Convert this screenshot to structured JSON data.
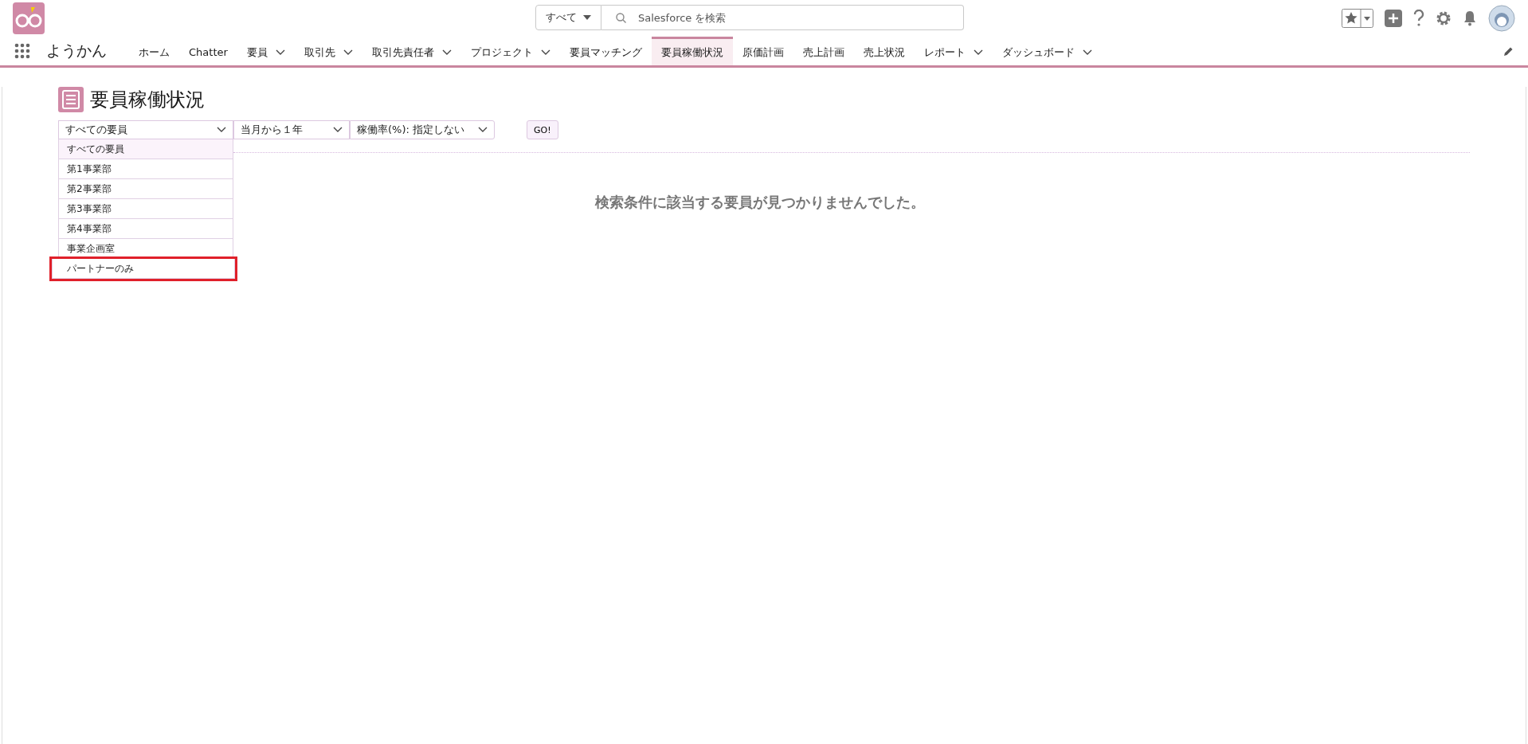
{
  "search": {
    "scope": "すべて",
    "placeholder": "Salesforce を検索"
  },
  "app_name": "ようかん",
  "nav": [
    {
      "label": "ホーム",
      "menu": false,
      "selected": false
    },
    {
      "label": "Chatter",
      "menu": false,
      "selected": false
    },
    {
      "label": "要員",
      "menu": true,
      "selected": false
    },
    {
      "label": "取引先",
      "menu": true,
      "selected": false
    },
    {
      "label": "取引先責任者",
      "menu": true,
      "selected": false
    },
    {
      "label": "プロジェクト",
      "menu": true,
      "selected": false
    },
    {
      "label": "要員マッチング",
      "menu": false,
      "selected": false
    },
    {
      "label": "要員稼働状況",
      "menu": false,
      "selected": true
    },
    {
      "label": "原価計画",
      "menu": false,
      "selected": false
    },
    {
      "label": "売上計画",
      "menu": false,
      "selected": false
    },
    {
      "label": "売上状況",
      "menu": false,
      "selected": false
    },
    {
      "label": "レポート",
      "menu": true,
      "selected": false
    },
    {
      "label": "ダッシュボード",
      "menu": true,
      "selected": false
    }
  ],
  "page_title": "要員稼働状況",
  "filters": [
    {
      "value": "すべての要員"
    },
    {
      "value": "当月から１年"
    },
    {
      "value": "稼働率(%): 指定しない"
    }
  ],
  "go_button": "GO!",
  "dropdown": [
    {
      "label": "すべての要員",
      "selected": true,
      "marked": false
    },
    {
      "label": "第1事業部",
      "selected": false,
      "marked": false
    },
    {
      "label": "第2事業部",
      "selected": false,
      "marked": false
    },
    {
      "label": "第3事業部",
      "selected": false,
      "marked": false
    },
    {
      "label": "第4事業部",
      "selected": false,
      "marked": false
    },
    {
      "label": "事業企画室",
      "selected": false,
      "marked": false
    },
    {
      "label": "パートナーのみ",
      "selected": false,
      "marked": true
    }
  ],
  "message": "検索条件に該当する要員が見つかりませんでした。"
}
